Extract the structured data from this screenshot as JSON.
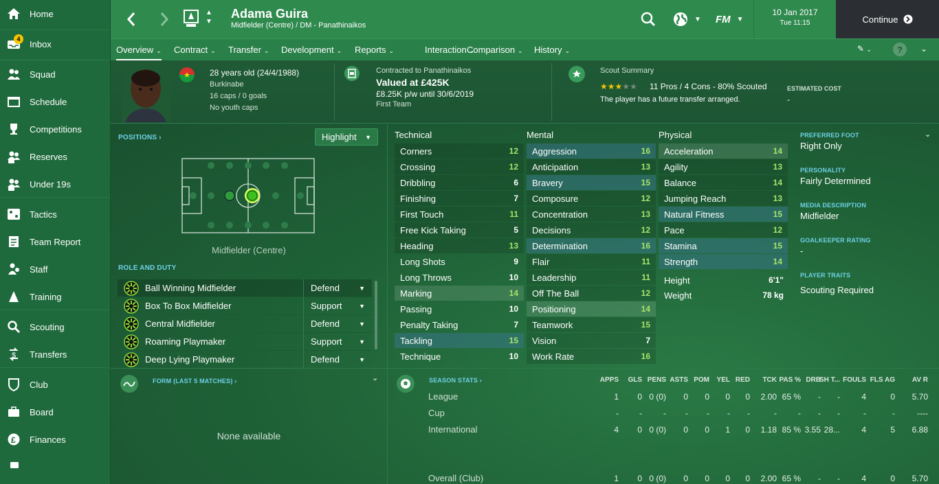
{
  "sidebar": {
    "items": [
      {
        "label": "Home",
        "icon": "home-icon"
      },
      {
        "label": "Inbox",
        "icon": "inbox-icon",
        "badge": "4"
      },
      {
        "label": "Squad",
        "icon": "squad-icon"
      },
      {
        "label": "Schedule",
        "icon": "schedule-icon"
      },
      {
        "label": "Competitions",
        "icon": "trophy-icon"
      },
      {
        "label": "Reserves",
        "icon": "reserves-icon"
      },
      {
        "label": "Under 19s",
        "icon": "u19-icon"
      },
      {
        "label": "Tactics",
        "icon": "tactics-icon"
      },
      {
        "label": "Team Report",
        "icon": "report-icon"
      },
      {
        "label": "Staff",
        "icon": "staff-icon"
      },
      {
        "label": "Training",
        "icon": "training-icon"
      },
      {
        "label": "Scouting",
        "icon": "scouting-icon"
      },
      {
        "label": "Transfers",
        "icon": "transfers-icon"
      },
      {
        "label": "Club",
        "icon": "club-icon"
      },
      {
        "label": "Board",
        "icon": "board-icon"
      },
      {
        "label": "Finances",
        "icon": "finances-icon"
      }
    ]
  },
  "header": {
    "player_name": "Adama Guira",
    "player_subtitle": "Midfielder (Centre) / DM - Panathinaikos",
    "logo_text": "FM",
    "date": "10 Jan 2017",
    "time": "Tue 11:15",
    "continue_label": "Continue"
  },
  "nav": {
    "tabs": [
      "Overview",
      "Contract",
      "Transfer",
      "Development",
      "Reports",
      "Interaction",
      "Comparison",
      "History"
    ]
  },
  "info": {
    "age": "28 years old (24/4/1988)",
    "nationality": "Burkinabe",
    "caps": "16 caps / 0 goals",
    "youth_caps": "No youth caps",
    "contract_label": "Contracted to Panathinaikos",
    "value": "Valued at £425K",
    "wage": "£8.25K p/w until 30/6/2019",
    "squad_status": "First Team",
    "scout_label": "Scout Summary",
    "scout_stars": 3,
    "scout_max_stars": 5,
    "scout_pros": "11 Pros / 4 Cons - 80% Scouted",
    "scout_note": "The player has a future transfer arranged.",
    "est_cost_label": "ESTIMATED COST",
    "est_cost_value": "-"
  },
  "positions": {
    "title": "POSITIONS",
    "highlight": "Highlight",
    "position_name": "Midfielder (Centre)"
  },
  "roles": {
    "title": "ROLE AND DUTY",
    "items": [
      {
        "name": "Ball Winning Midfielder",
        "duty": "Defend"
      },
      {
        "name": "Box To Box Midfielder",
        "duty": "Support"
      },
      {
        "name": "Central Midfielder",
        "duty": "Defend"
      },
      {
        "name": "Roaming Playmaker",
        "duty": "Support"
      },
      {
        "name": "Deep Lying Playmaker",
        "duty": "Defend"
      }
    ]
  },
  "attributes": {
    "technical_title": "Technical",
    "mental_title": "Mental",
    "physical_title": "Physical",
    "technical": [
      {
        "name": "Corners",
        "value": "12"
      },
      {
        "name": "Crossing",
        "value": "12"
      },
      {
        "name": "Dribbling",
        "value": "6"
      },
      {
        "name": "Finishing",
        "value": "7"
      },
      {
        "name": "First Touch",
        "value": "11"
      },
      {
        "name": "Free Kick Taking",
        "value": "5"
      },
      {
        "name": "Heading",
        "value": "13"
      },
      {
        "name": "Long Shots",
        "value": "9"
      },
      {
        "name": "Long Throws",
        "value": "10"
      },
      {
        "name": "Marking",
        "value": "14"
      },
      {
        "name": "Passing",
        "value": "10"
      },
      {
        "name": "Penalty Taking",
        "value": "7"
      },
      {
        "name": "Tackling",
        "value": "15"
      },
      {
        "name": "Technique",
        "value": "10"
      }
    ],
    "mental": [
      {
        "name": "Aggression",
        "value": "16"
      },
      {
        "name": "Anticipation",
        "value": "13"
      },
      {
        "name": "Bravery",
        "value": "15"
      },
      {
        "name": "Composure",
        "value": "12"
      },
      {
        "name": "Concentration",
        "value": "13"
      },
      {
        "name": "Decisions",
        "value": "12"
      },
      {
        "name": "Determination",
        "value": "16"
      },
      {
        "name": "Flair",
        "value": "11"
      },
      {
        "name": "Leadership",
        "value": "11"
      },
      {
        "name": "Off The Ball",
        "value": "12"
      },
      {
        "name": "Positioning",
        "value": "14"
      },
      {
        "name": "Teamwork",
        "value": "15"
      },
      {
        "name": "Vision",
        "value": "7"
      },
      {
        "name": "Work Rate",
        "value": "16"
      }
    ],
    "physical": [
      {
        "name": "Acceleration",
        "value": "14"
      },
      {
        "name": "Agility",
        "value": "13"
      },
      {
        "name": "Balance",
        "value": "14"
      },
      {
        "name": "Jumping Reach",
        "value": "13"
      },
      {
        "name": "Natural Fitness",
        "value": "15"
      },
      {
        "name": "Pace",
        "value": "12"
      },
      {
        "name": "Stamina",
        "value": "15"
      },
      {
        "name": "Strength",
        "value": "14"
      }
    ],
    "height_label": "Height",
    "height": "6'1\"",
    "weight_label": "Weight",
    "weight": "78 kg"
  },
  "details": {
    "pref_foot_label": "PREFERRED FOOT",
    "pref_foot": "Right Only",
    "personality_label": "PERSONALITY",
    "personality": "Fairly Determined",
    "media_label": "MEDIA DESCRIPTION",
    "media": "Midfielder",
    "gk_label": "GOALKEEPER RATING",
    "gk": "-",
    "traits_label": "PLAYER TRAITS",
    "traits": "Scouting Required"
  },
  "form": {
    "title": "FORM (LAST 5 MATCHES)",
    "empty": "None available"
  },
  "season": {
    "title": "SEASON STATS",
    "headers": [
      "APPS",
      "GLS",
      "PENS",
      "ASTS",
      "POM",
      "YEL",
      "RED",
      "TCK",
      "PAS %",
      "DRB",
      "SH T...",
      "FOULS",
      "FLS AG",
      "AV R"
    ],
    "rows": [
      {
        "label": "League",
        "cells": [
          "1",
          "0",
          "0 (0)",
          "0",
          "0",
          "0",
          "0",
          "2.00",
          "65 %",
          "-",
          "-",
          "4",
          "0",
          "5.70"
        ]
      },
      {
        "label": "Cup",
        "cells": [
          "-",
          "-",
          "-",
          "-",
          "-",
          "-",
          "-",
          "-",
          "-",
          "-",
          "-",
          "-",
          "-",
          "----"
        ]
      },
      {
        "label": "International",
        "cells": [
          "4",
          "0",
          "0 (0)",
          "0",
          "0",
          "1",
          "0",
          "1.18",
          "85 %",
          "3.55",
          "28...",
          "4",
          "5",
          "6.88"
        ]
      },
      {
        "label": "Overall (Club)",
        "cells": [
          "1",
          "0",
          "0 (0)",
          "0",
          "0",
          "0",
          "0",
          "2.00",
          "65 %",
          "-",
          "-",
          "4",
          "0",
          "5.70"
        ]
      }
    ]
  },
  "colors": {
    "accent": "#a6e46b",
    "header": "#2f8a4e",
    "sidebar": "#1f6a3c",
    "continue_bg": "#2b2f33"
  }
}
